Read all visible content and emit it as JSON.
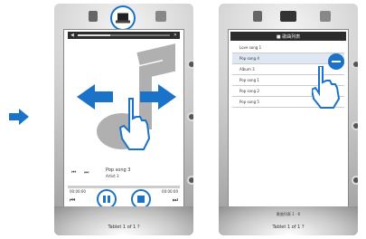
{
  "left_device": {
    "song_title": "Pop song 3",
    "song_artist": "Artist 3",
    "time_elapsed": "00:00:00",
    "time_total": "00:00:00",
    "bottom_label": "Tablet 1 of 1 ?",
    "volume_level": 0.35
  },
  "right_device": {
    "header": "■ 歌曲列表",
    "items": [
      "Love song 1",
      "Pop song 4",
      "Album 3",
      "Pop song 1",
      "Pop song 2",
      "Pop song 5"
    ],
    "bottom_label": "Tablet 1 of 1 ?",
    "mid_label": "歌曲列表 1 · 6"
  },
  "colors": {
    "accent": "#1a73c8",
    "dark": "#2c2c2c"
  }
}
